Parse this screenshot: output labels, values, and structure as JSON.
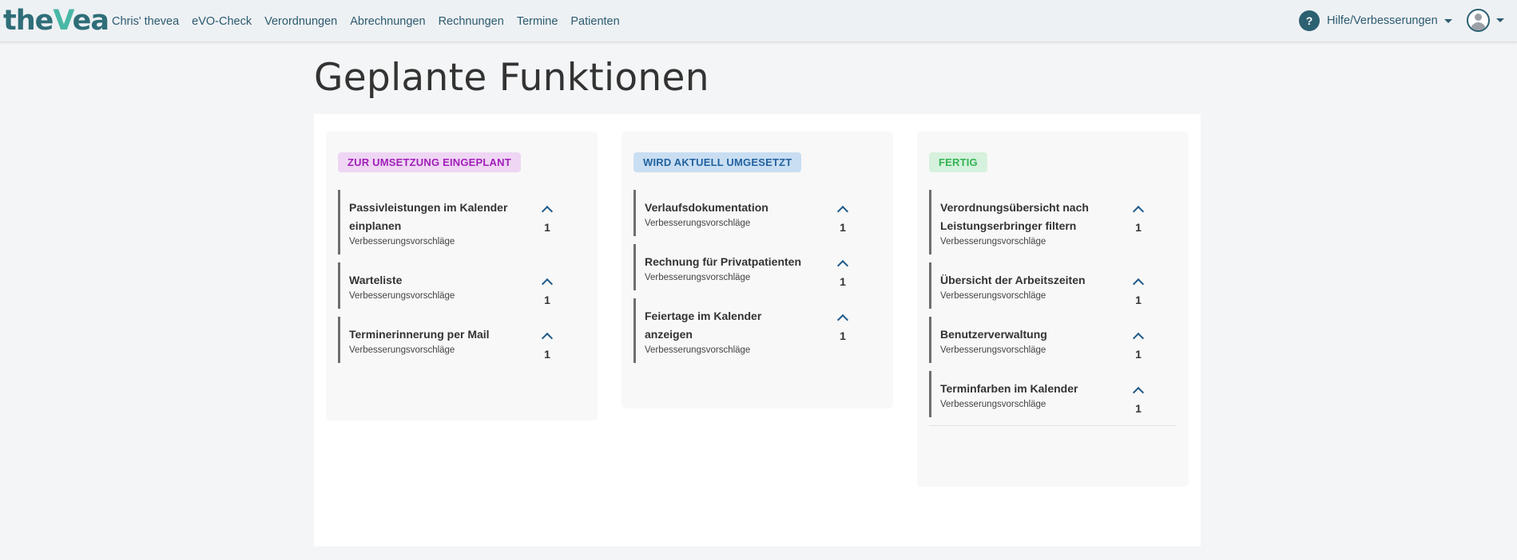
{
  "brand": {
    "part1": "the",
    "part2": "V",
    "part3": "ea"
  },
  "nav": [
    "Chris' thevea",
    "eVO-Check",
    "Verordnungen",
    "Abrechnungen",
    "Rechnungen",
    "Termine",
    "Patienten"
  ],
  "help": {
    "icon": "?",
    "label": "Hilfe/Verbesserungen"
  },
  "page_title": "Geplante Funktionen",
  "colors": {
    "accent": "#2c6171",
    "brand": "#2e6e79",
    "brand_v": "#49b8a6"
  },
  "columns": [
    {
      "label": "ZUR UMSETZUNG EINGEPLANT",
      "badge_bg": "#efd6f4",
      "badge_color": "#a120b8",
      "cards": [
        {
          "title": "Passivleistungen im Kalender einplanen",
          "sub": "Verbesserungsvorschläge",
          "votes": "1"
        },
        {
          "title": "Warteliste",
          "sub": "Verbesserungsvorschläge",
          "votes": "1"
        },
        {
          "title": "Terminerinnerung per Mail",
          "sub": "Verbesserungsvorschläge",
          "votes": "1"
        }
      ]
    },
    {
      "label": "WIRD AKTUELL UMGESETZT",
      "badge_bg": "#c9def2",
      "badge_color": "#2262a0",
      "cards": [
        {
          "title": "Verlaufsdokumentation",
          "sub": "Verbesserungsvorschläge",
          "votes": "1"
        },
        {
          "title": "Rechnung für Privatpatienten",
          "sub": "Verbesserungsvorschläge",
          "votes": "1"
        },
        {
          "title": "Feiertage im Kalender anzeigen",
          "sub": "Verbesserungsvorschläge",
          "votes": "1"
        }
      ]
    },
    {
      "label": "FERTIG",
      "badge_bg": "#d6f1dd",
      "badge_color": "#34b352",
      "cards": [
        {
          "title": "Verordnungsübersicht nach Leistungserbringer filtern",
          "sub": "Verbesserungsvorschläge",
          "votes": "1"
        },
        {
          "title": "Übersicht der Arbeitszeiten",
          "sub": "Verbesserungsvorschläge",
          "votes": "1"
        },
        {
          "title": "Benutzerverwaltung",
          "sub": "Verbesserungsvorschläge",
          "votes": "1"
        },
        {
          "title": "Terminfarben im Kalender",
          "sub": "Verbesserungsvorschläge",
          "votes": "1"
        }
      ]
    }
  ]
}
